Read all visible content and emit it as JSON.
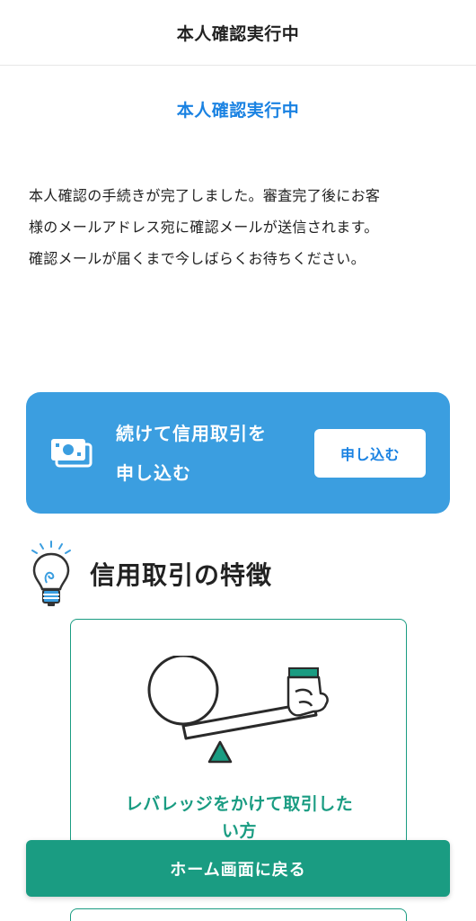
{
  "nav": {
    "title": "本人確認実行中"
  },
  "page": {
    "heading": "本人確認実行中"
  },
  "message": {
    "lines": [
      "本人確認の手続きが完了しました。審査完了後にお客",
      "様のメールアドレス宛に確認メールが送信されます。",
      "確認メールが届くまで今しばらくお待ちください。"
    ]
  },
  "banner": {
    "text_lines": [
      "続けて信用取引を",
      "申し込む"
    ],
    "button_label": "申し込む",
    "icon": "money-icon"
  },
  "features": {
    "title": "信用取引の特徴",
    "icon": "lightbulb-icon",
    "cards": [
      {
        "title_lines": [
          "レバレッジをかけて取引した",
          "い方"
        ],
        "illustration": "leverage-illustration"
      }
    ]
  },
  "footer": {
    "home_button_label": "ホーム画面に戻る"
  },
  "colors": {
    "blue_accent": "#1a82e2",
    "banner_blue": "#3b9ee0",
    "teal": "#1a9c82",
    "text": "#222222"
  }
}
